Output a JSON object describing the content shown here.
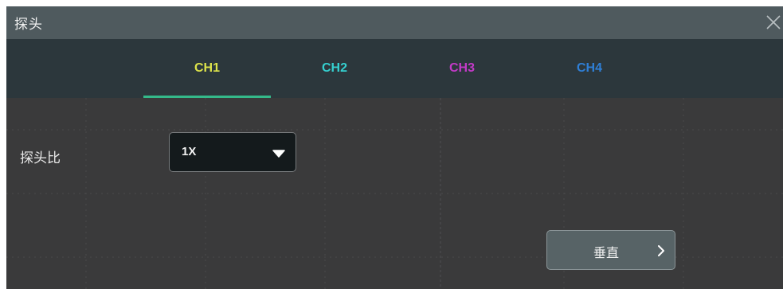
{
  "dialog": {
    "title": "探头",
    "close_icon": "close-icon"
  },
  "tabs": [
    {
      "label": "CH1",
      "color": "#dde34a",
      "selected": true
    },
    {
      "label": "CH2",
      "color": "#35d0d0",
      "selected": false
    },
    {
      "label": "CH3",
      "color": "#c43ac8",
      "selected": false
    },
    {
      "label": "CH4",
      "color": "#2f7fd6",
      "selected": false
    }
  ],
  "accent_color": "#34b98a",
  "probe_ratio": {
    "label": "探头比",
    "value": "1X",
    "caret_icon": "caret-down-icon"
  },
  "vertical_button": {
    "label": "垂直",
    "chevron_icon": "chevron-right-icon"
  }
}
